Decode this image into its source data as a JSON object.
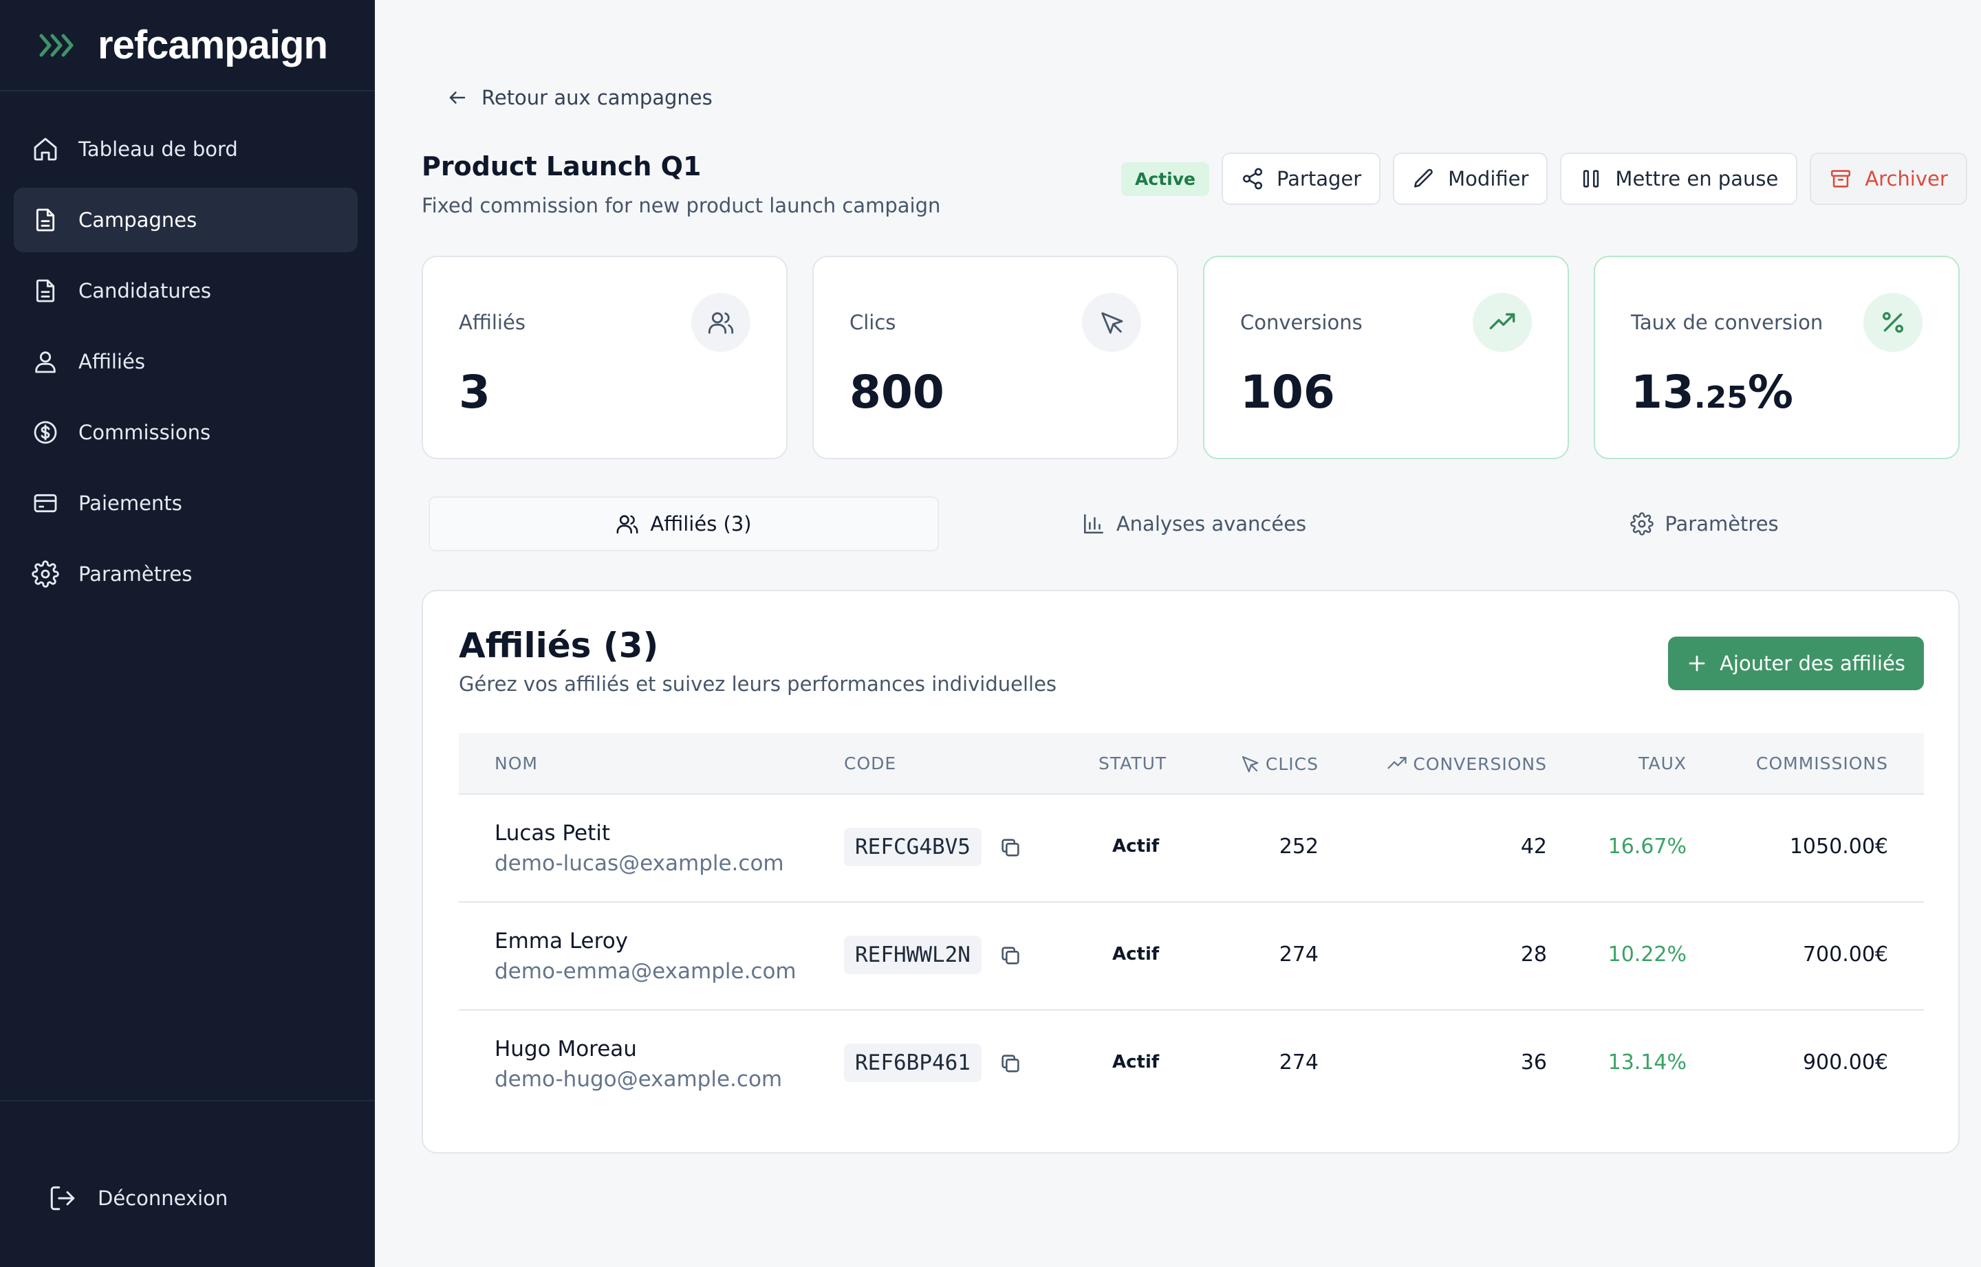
{
  "app": {
    "name": "refcampaign"
  },
  "sidebar": {
    "items": [
      {
        "label": "Tableau de bord",
        "icon": "home-icon"
      },
      {
        "label": "Campagnes",
        "icon": "document-icon",
        "active": true
      },
      {
        "label": "Candidatures",
        "icon": "document-icon"
      },
      {
        "label": "Affiliés",
        "icon": "users-icon"
      },
      {
        "label": "Commissions",
        "icon": "dollar-circle-icon"
      },
      {
        "label": "Paiements",
        "icon": "credit-card-icon"
      },
      {
        "label": "Paramètres",
        "icon": "gear-icon"
      }
    ],
    "logout_label": "Déconnexion"
  },
  "header": {
    "back_label": "Retour aux campagnes",
    "title": "Product Launch Q1",
    "subtitle": "Fixed commission for new product launch campaign",
    "status_badge": "Active",
    "actions": {
      "share": "Partager",
      "edit": "Modifier",
      "pause": "Mettre en pause",
      "archive": "Archiver"
    }
  },
  "stats": [
    {
      "label": "Affiliés",
      "value": "3",
      "icon": "users-icon"
    },
    {
      "label": "Clics",
      "value": "800",
      "icon": "cursor-icon"
    },
    {
      "label": "Conversions",
      "value": "106",
      "icon": "trending-up-icon"
    },
    {
      "label": "Taux de conversion",
      "value_main": "13",
      "value_decimal": ".25",
      "value_suffix": "%",
      "icon": "percent-icon"
    }
  ],
  "tabs": [
    {
      "label": "Affiliés (3)",
      "icon": "users-icon",
      "active": true
    },
    {
      "label": "Analyses avancées",
      "icon": "bar-chart-icon"
    },
    {
      "label": "Paramètres",
      "icon": "gear-icon"
    }
  ],
  "panel": {
    "title": "Affiliés (3)",
    "subtitle": "Gérez vos affiliés et suivez leurs performances individuelles",
    "add_button": "Ajouter des affiliés"
  },
  "table": {
    "headers": {
      "name": "NOM",
      "code": "CODE",
      "status": "STATUT",
      "clicks": "CLICS",
      "conversions": "CONVERSIONS",
      "rate": "TAUX",
      "commissions": "COMMISSIONS"
    },
    "rows": [
      {
        "name": "Lucas Petit",
        "email": "demo-lucas@example.com",
        "code": "REFCG4BV5",
        "status": "Actif",
        "clicks": "252",
        "conversions": "42",
        "rate": "16.67%",
        "commissions": "1050.00€"
      },
      {
        "name": "Emma Leroy",
        "email": "demo-emma@example.com",
        "code": "REFHWWL2N",
        "status": "Actif",
        "clicks": "274",
        "conversions": "28",
        "rate": "10.22%",
        "commissions": "700.00€"
      },
      {
        "name": "Hugo Moreau",
        "email": "demo-hugo@example.com",
        "code": "REF6BP461",
        "status": "Actif",
        "clicks": "274",
        "conversions": "36",
        "rate": "13.14%",
        "commissions": "900.00€"
      }
    ]
  },
  "colors": {
    "sidebar_bg": "#141b2d",
    "accent_green": "#3f9467",
    "danger": "#dc4a3d",
    "rate_green": "#3aa266"
  }
}
